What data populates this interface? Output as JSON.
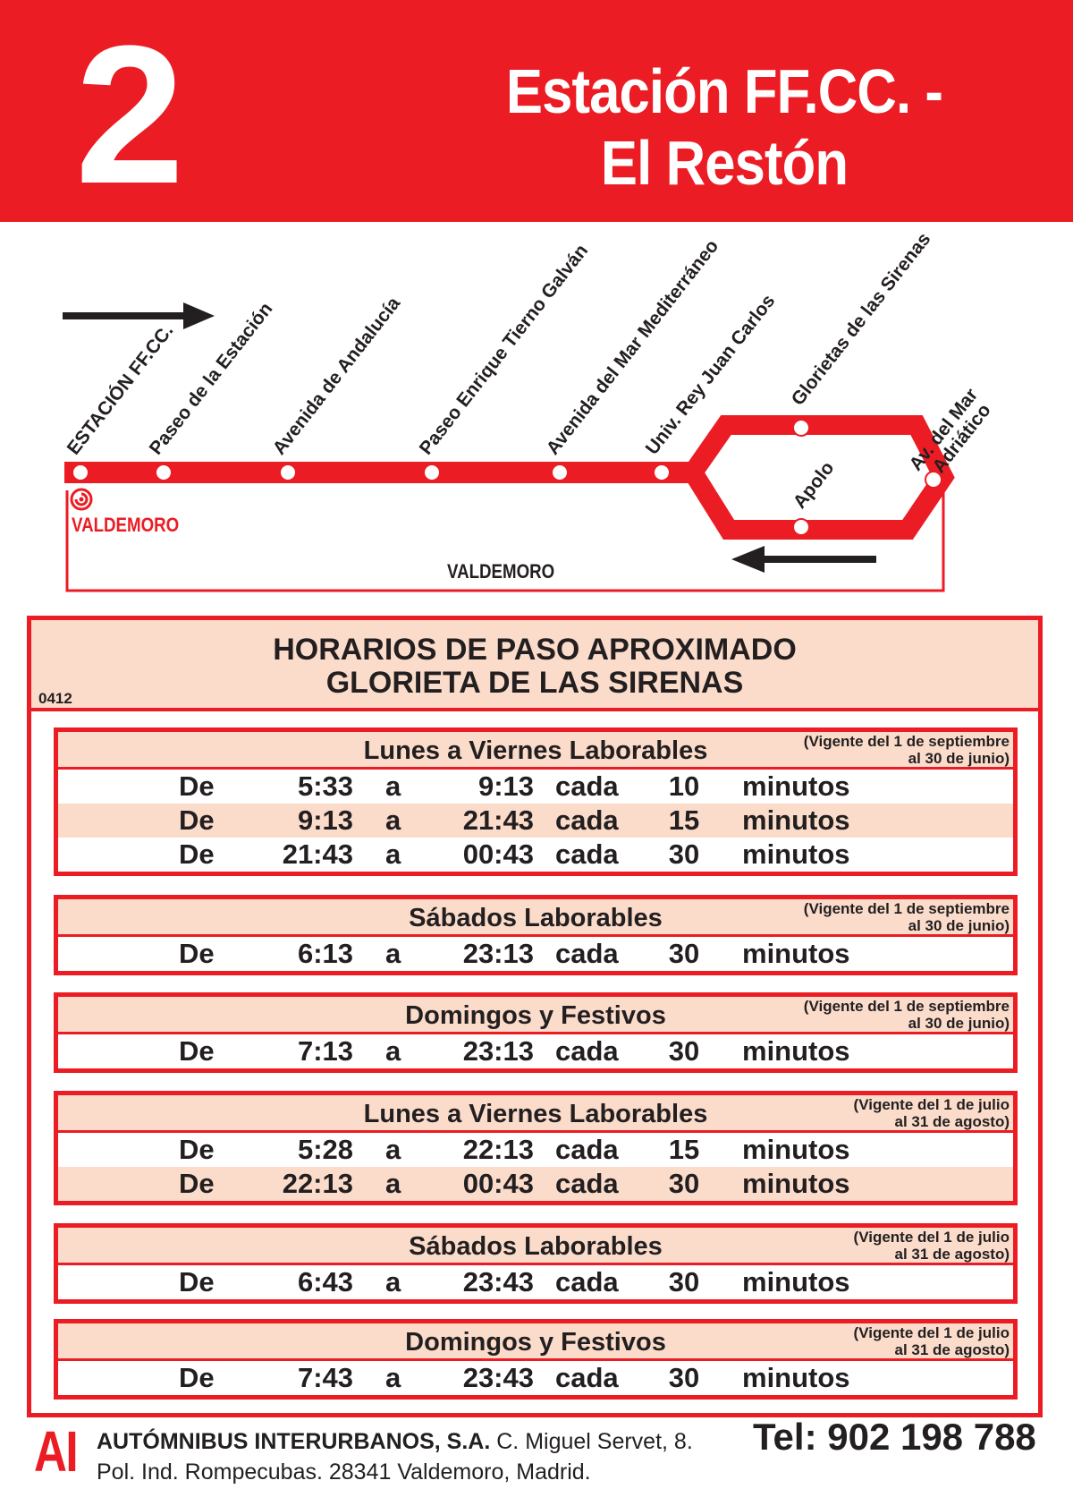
{
  "header": {
    "line_number": "2",
    "route_line1": "Estación FF.CC. -",
    "route_line2": "El Restón",
    "color": "#ec1c24"
  },
  "map": {
    "stops": [
      "ESTACIÓN FF.CC.",
      "Paseo de la Estación",
      "Avenida de Andalucía",
      "Paseo Enrique Tierno Galván",
      "Avenida del Mar Mediterráneo",
      "Univ. Rey Juan Carlos",
      "Glorietas de las Sirenas",
      "Av. del Mar",
      "Adriático",
      "Apolo"
    ],
    "town_origin": "VALDEMORO",
    "town_bottom": "VALDEMORO"
  },
  "schedule": {
    "title_line1": "HORARIOS DE PASO APROXIMADO",
    "title_line2": "GLORIETA DE LAS SIRENAS",
    "code": "0412",
    "labels": {
      "de": "De",
      "a": "a",
      "cada": "cada",
      "minutos": "minutos"
    },
    "blocks": [
      {
        "title": "Lunes a Viernes Laborables",
        "validity1": "(Vigente del 1 de septiembre",
        "validity2": "al 30 de junio)",
        "rows": [
          {
            "from": "5:33",
            "to": "9:13",
            "every": "10"
          },
          {
            "from": "9:13",
            "to": "21:43",
            "every": "15"
          },
          {
            "from": "21:43",
            "to": "00:43",
            "every": "30"
          }
        ]
      },
      {
        "title": "Sábados Laborables",
        "validity1": "(Vigente del 1 de septiembre",
        "validity2": "al 30 de junio)",
        "rows": [
          {
            "from": "6:13",
            "to": "23:13",
            "every": "30"
          }
        ]
      },
      {
        "title": "Domingos y Festivos",
        "validity1": "(Vigente del 1 de septiembre",
        "validity2": "al 30 de junio)",
        "rows": [
          {
            "from": "7:13",
            "to": "23:13",
            "every": "30"
          }
        ]
      },
      {
        "title": "Lunes a Viernes Laborables",
        "validity1": "(Vigente del 1 de julio",
        "validity2": "al 31 de agosto)",
        "rows": [
          {
            "from": "5:28",
            "to": "22:13",
            "every": "15"
          },
          {
            "from": "22:13",
            "to": "00:43",
            "every": "30"
          }
        ]
      },
      {
        "title": "Sábados Laborables",
        "validity1": "(Vigente del 1 de julio",
        "validity2": "al 31 de agosto)",
        "rows": [
          {
            "from": "6:43",
            "to": "23:43",
            "every": "30"
          }
        ]
      },
      {
        "title": "Domingos y Festivos",
        "validity1": "(Vigente del 1 de julio",
        "validity2": "al 31 de agosto)",
        "rows": [
          {
            "from": "7:43",
            "to": "23:43",
            "every": "30"
          }
        ]
      }
    ]
  },
  "footer": {
    "logo": "AI",
    "company_name": "AUTÓMNIBUS INTERURBANOS, S.A.",
    "address1": " C. Miguel Servet, 8.",
    "address2": "Pol. Ind. Rompecubas. 28341 Valdemoro, Madrid.",
    "phone": "Tel: 902 198 788"
  },
  "colors": {
    "accent": "#ec1c24",
    "shade": "#fbdccb",
    "text": "#231f20"
  }
}
